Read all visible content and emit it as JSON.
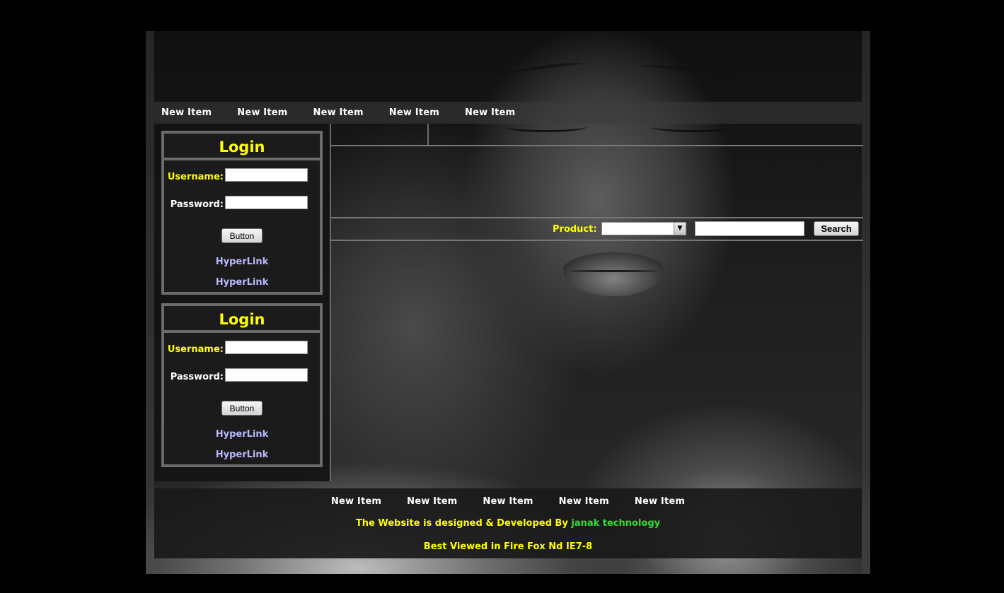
{
  "top_nav": [
    "New Item",
    "New Item",
    "New Item",
    "New Item",
    "New Item"
  ],
  "login_boxes": [
    {
      "title": "Login",
      "username_label": "Username:",
      "password_label": "Password:",
      "button_label": "Button",
      "links": [
        "HyperLink",
        "HyperLink"
      ]
    },
    {
      "title": "Login",
      "username_label": "Username:",
      "password_label": "Password:",
      "button_label": "Button",
      "links": [
        "HyperLink",
        "HyperLink"
      ]
    }
  ],
  "search": {
    "product_label": "Product:",
    "product_selected": "",
    "query_value": "",
    "button_label": "Search"
  },
  "footer": {
    "nav": [
      "New Item",
      "New Item",
      "New Item",
      "New Item",
      "New Item"
    ],
    "credit_text": "The Website is designed & Developed By",
    "credit_company": "janak technology",
    "best_viewed": "Best Viewed in Fire Fox Nd IE7-8"
  },
  "colors": {
    "accent_yellow": "#ffff00",
    "link": "#b8b8ff",
    "company_green": "#33dd33"
  }
}
